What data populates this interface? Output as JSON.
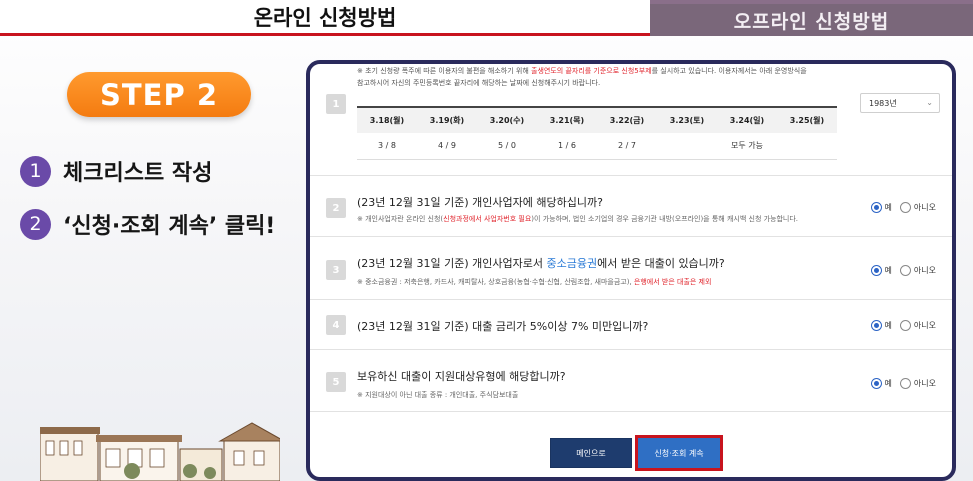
{
  "tabs": {
    "online": "온라인 신청방법",
    "offline": "오프라인 신청방법"
  },
  "left": {
    "step_badge": "STEP 2",
    "steps": [
      {
        "num": "1",
        "text": "체크리스트 작성"
      },
      {
        "num": "2",
        "text": "‘신청·조회 계속’ 클릭!"
      }
    ]
  },
  "form": {
    "intro_line1_a": "※ 초기 신청량 폭주에 따른 이용자의 불편을 해소하기 위해 ",
    "intro_line1_red": "출생연도의 끝자리를 기준으로 신청5부제",
    "intro_line1_b": "를 실시하고 있습니다. 이용자께서는 아래 운영방식을",
    "intro_line2": "참고하시어 자신의 주민등록번호 끝자리에 해당하는 날짜에 신청해주시기 바랍니다.",
    "q1_num": "1",
    "year_select_value": "1983년",
    "date_headers": [
      "3.18(월)",
      "3.19(화)",
      "3.20(수)",
      "3.21(목)",
      "3.22(금)",
      "3.23(토)",
      "3.24(일)",
      "3.25(월)"
    ],
    "date_values": [
      "3 / 8",
      "4 / 9",
      "5 / 0",
      "1 / 6",
      "2 / 7"
    ],
    "date_all": "모두 가능",
    "questions": [
      {
        "num": "2",
        "title": "(23년 12월 31일 기준) 개인사업자에 해당하십니까?",
        "note_a": "※ 개인사업자란 온라인 신청(",
        "note_red": "신청과정에서 사업자번호 필요",
        "note_b": ")이 가능하며, 법인 소기업의 경우 금융기관 내방(오프라인)을 통해 캐시백 신청 가능합니다."
      },
      {
        "num": "3",
        "title_a": "(23년 12월 31일 기준) 개인사업자로서 ",
        "title_blue": "중소금융권",
        "title_b": "에서 받은 대출이 있습니까?",
        "note_a": "※ 중소금융권 : 저축은행, 카드사, 캐피탈사, 상호금융(농협·수협·신협, 산림조합, 새마을금고), ",
        "note_red": "은행에서 받은 대출은 제외"
      },
      {
        "num": "4",
        "title": "(23년 12월 31일 기준) 대출 금리가 5%이상 7% 미만입니까?"
      },
      {
        "num": "5",
        "title": "보유하신 대출이 지원대상유형에 해당합니까?",
        "note": "※ 지원대상이 아닌 대출 종류 : 개인대출, 주식담보대출"
      }
    ],
    "radio_yes": "예",
    "radio_no": "아니오",
    "btn_main": "메인으로",
    "btn_continue": "신청·조회 계속"
  }
}
